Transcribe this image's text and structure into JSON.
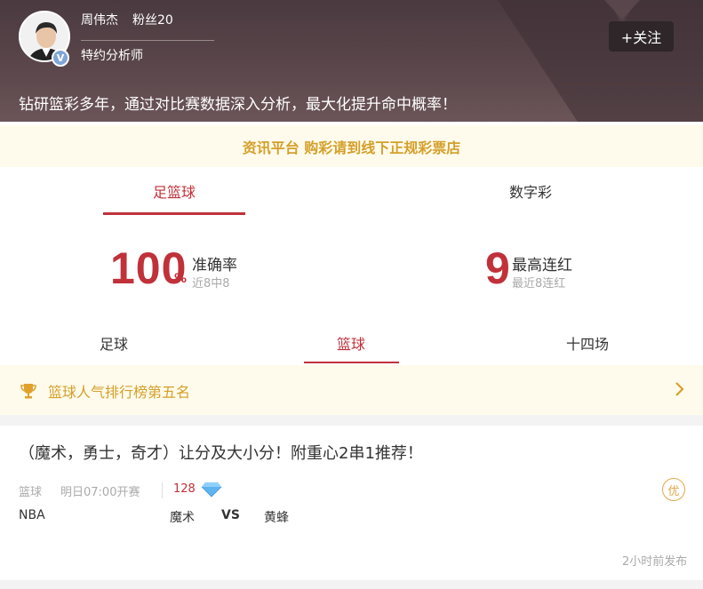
{
  "expert": {
    "name": "周伟杰",
    "fans": "粉丝20",
    "title": "特约分析师",
    "follow_label": "+关注",
    "intro": "钻研篮彩多年，通过对比赛数据深入分析，最大化提升命中概率！",
    "verified_badge": "V"
  },
  "notice": {
    "text": "资讯平台 购彩请到线下正规彩票店"
  },
  "main_tabs": [
    {
      "label": "足篮球",
      "active": true
    },
    {
      "label": "数字彩",
      "active": false
    }
  ],
  "stats": {
    "accuracy": {
      "value": "100",
      "unit": "%",
      "label": "准确率",
      "sub": "近8中8"
    },
    "streak": {
      "value": "9",
      "label": "最高连红",
      "sub": "最近8连红"
    }
  },
  "sub_tabs": [
    {
      "label": "足球",
      "active": false
    },
    {
      "label": "篮球",
      "active": true
    },
    {
      "label": "十四场",
      "active": false
    }
  ],
  "rank": {
    "text": "篮球人气排行榜第五名"
  },
  "article": {
    "title": "（魔术，勇士，奇才）让分及大小分！附重心2串1推荐！",
    "sport": "篮球",
    "start_time": "明日07:00开赛",
    "price": "128",
    "badge": "优",
    "league": "NBA",
    "home": "魔术",
    "vs": "VS",
    "away": "黄蜂",
    "published": "2小时前发布"
  },
  "colors": {
    "accent": "#c0313a",
    "gold": "#d4a02a",
    "header_bg": "#4a3a40"
  }
}
